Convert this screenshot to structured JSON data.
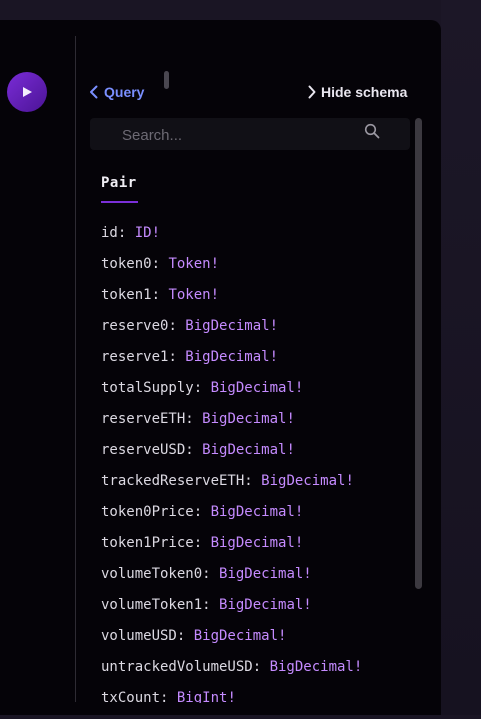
{
  "header": {
    "back_label": "Query",
    "hide_schema_label": "Hide schema"
  },
  "search": {
    "placeholder": "Search..."
  },
  "schema": {
    "type_name": "Pair",
    "fields": [
      {
        "name": "id",
        "type": "ID!"
      },
      {
        "name": "token0",
        "type": "Token!"
      },
      {
        "name": "token1",
        "type": "Token!"
      },
      {
        "name": "reserve0",
        "type": "BigDecimal!"
      },
      {
        "name": "reserve1",
        "type": "BigDecimal!"
      },
      {
        "name": "totalSupply",
        "type": "BigDecimal!"
      },
      {
        "name": "reserveETH",
        "type": "BigDecimal!"
      },
      {
        "name": "reserveUSD",
        "type": "BigDecimal!"
      },
      {
        "name": "trackedReserveETH",
        "type": "BigDecimal!"
      },
      {
        "name": "token0Price",
        "type": "BigDecimal!"
      },
      {
        "name": "token1Price",
        "type": "BigDecimal!"
      },
      {
        "name": "volumeToken0",
        "type": "BigDecimal!"
      },
      {
        "name": "volumeToken1",
        "type": "BigDecimal!"
      },
      {
        "name": "volumeUSD",
        "type": "BigDecimal!"
      },
      {
        "name": "untrackedVolumeUSD",
        "type": "BigDecimal!"
      },
      {
        "name": "txCount",
        "type": "BigInt!"
      }
    ]
  },
  "icons": {
    "run": "play-icon",
    "back": "chevron-left-icon",
    "hide": "chevron-right-icon",
    "search": "search-icon"
  },
  "colors": {
    "accent": "#7b2fd9",
    "link": "#7a8fff",
    "type": "#c58bff"
  }
}
